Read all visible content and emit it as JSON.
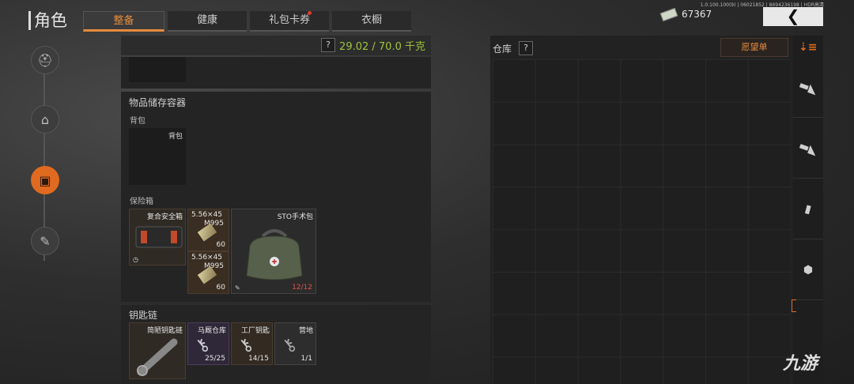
{
  "header": {
    "title": "角色",
    "tabs": [
      {
        "label": "整备",
        "active": true
      },
      {
        "label": "健康",
        "active": false
      },
      {
        "label": "礼包卡券",
        "active": false,
        "notify": true
      },
      {
        "label": "衣橱",
        "active": false
      }
    ],
    "version": "1.0.100.100(9) | 06021852 | 86942361​98 | HDR高清",
    "money": "67367",
    "back_icon": "chevron-left-icon"
  },
  "sidebar": {
    "items": [
      {
        "icon": "helmet-icon",
        "active": false
      },
      {
        "icon": "vest-icon",
        "active": false
      },
      {
        "icon": "backpack-icon",
        "active": true
      },
      {
        "icon": "wrench-icon",
        "active": false
      }
    ]
  },
  "loadout": {
    "help": "?",
    "weight": "29.02 / 70.0 千克",
    "storage_title": "物品储存容器",
    "backpack_label": "背包",
    "backpack_slot_text": "背包",
    "safebox_label": "保险箱",
    "safebox": {
      "name": "复合安全箱"
    },
    "ammo": [
      {
        "caliber": "5.56×45",
        "type": "M995",
        "count": "60"
      },
      {
        "caliber": "5.56×45",
        "type": "M995",
        "count": "60"
      }
    ],
    "medkit": {
      "name": "STO手术包",
      "count": "12/12"
    },
    "keychain_title": "钥匙链",
    "keychain": {
      "name": "简陋钥匙链"
    },
    "keys": [
      {
        "name": "马厩仓库",
        "count": "25/25"
      },
      {
        "name": "工厂钥匙",
        "count": "14/15"
      },
      {
        "name": "营地",
        "count": "1/1"
      }
    ]
  },
  "warehouse": {
    "title": "仓库",
    "help": "?",
    "wish_button": "愿望单",
    "filters": [
      "sort-icon",
      "rifle-icon",
      "rifle-icon",
      "magazine-icon",
      "box-icon"
    ]
  },
  "watermark": "九游"
}
